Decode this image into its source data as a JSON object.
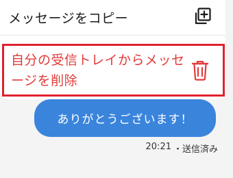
{
  "context_menu": {
    "copy": {
      "label": "メッセージをコピー",
      "icon": "copy-icon"
    },
    "delete": {
      "label": "自分の受信トレイからメッセージを削除",
      "icon": "trash-icon",
      "color": "#e23b3b"
    }
  },
  "message": {
    "text": "ありがとうございます！",
    "time": "20:21",
    "status": "・送信済み",
    "bubble_color": "#3a84dc"
  }
}
